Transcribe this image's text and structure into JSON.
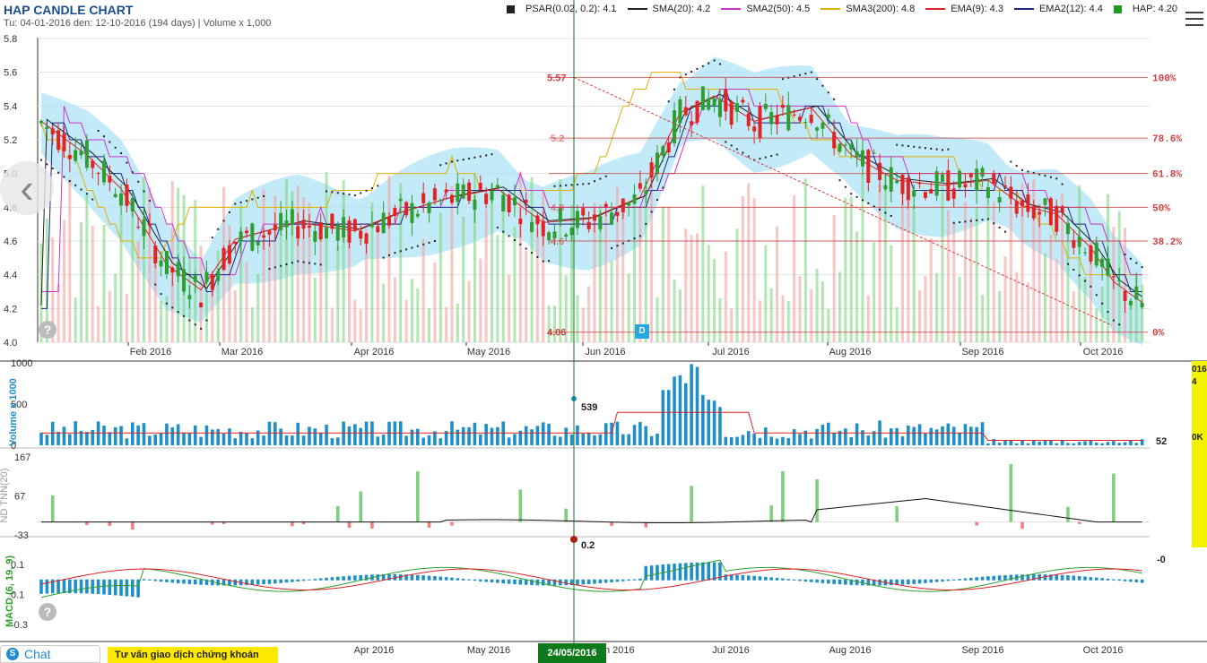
{
  "header": {
    "title": "HAP CANDLE CHART",
    "subtitle": "Tu: 04-01-2016 den: 12-10-2016 (194 days) | Volume x 1,000"
  },
  "legend": [
    {
      "label": "PSAR(0.02, 0.2): 4.1",
      "color": "#222222",
      "kind": "square"
    },
    {
      "label": "SMA(20): 4.2",
      "color": "#222222",
      "kind": "line"
    },
    {
      "label": "SMA2(50): 4.5",
      "color": "#cc33cc",
      "kind": "line"
    },
    {
      "label": "SMA3(200): 4.8",
      "color": "#e0b000",
      "kind": "line"
    },
    {
      "label": "EMA(9): 4.3",
      "color": "#dd2222",
      "kind": "line"
    },
    {
      "label": "EMA2(12): 4.4",
      "color": "#222288",
      "kind": "line"
    },
    {
      "label": "HAP: 4.20",
      "color": "#229922",
      "kind": "square"
    }
  ],
  "colors": {
    "up": "#2e9e2e",
    "down": "#e52222",
    "band": "#aee3f5",
    "volume": "#1f8fc8",
    "grid": "#999999",
    "cursor": "#0f7a1c"
  },
  "icons": {
    "menu": "hamburger-menu-icon",
    "nav": "chevron-left-icon",
    "help": "question-icon",
    "chat": "skype-icon"
  },
  "chat": {
    "label": "Chat"
  },
  "advice": {
    "label": "Tư vấn giao dịch chứng khoán"
  },
  "cursor": {
    "date_label": "24/05/2016",
    "volume_value": "539",
    "macd_value": "0.2"
  },
  "marker": {
    "label": "D"
  },
  "side_panel": {
    "lines": [
      "016",
      "4",
      "",
      "0K"
    ]
  },
  "chart_data": [
    {
      "type": "candlestick",
      "name": "price",
      "ylim": [
        4.0,
        5.8
      ],
      "yticks": [
        4.0,
        4.2,
        4.4,
        4.6,
        4.8,
        5.0,
        5.2,
        5.4,
        5.6,
        5.8
      ],
      "month_labels": [
        "Feb 2016",
        "Mar 2016",
        "Apr 2016",
        "May 2016",
        "Jun 2016",
        "Jul 2016",
        "Aug 2016",
        "Sep 2016",
        "Oct 2016"
      ],
      "fibonacci": {
        "high_label": "5.57",
        "low_label": "4.06",
        "levels": [
          {
            "value": 5.57,
            "label": "100%"
          },
          {
            "value": 5.21,
            "label": "78.6%"
          },
          {
            "value": 5.0,
            "label": "61.8%"
          },
          {
            "value": 4.8,
            "label": "50%"
          },
          {
            "value": 4.6,
            "label": "38.2%"
          },
          {
            "value": 4.06,
            "label": "0%"
          }
        ],
        "inner_labels": [
          "5.2",
          "4.8",
          "4.6"
        ]
      },
      "last_close": 4.2,
      "sma200_last": 4.8
    },
    {
      "type": "bar",
      "name": "volume",
      "ylabel": "Volume x 1000",
      "ylim": [
        0,
        1000
      ],
      "yticks": [
        0,
        500,
        1000
      ],
      "last_label": "52"
    },
    {
      "type": "bar",
      "name": "nd-tnn",
      "ylabel": "ND TNN(20)",
      "ylim": [
        -33,
        167
      ],
      "yticks": [
        -33,
        67,
        167
      ]
    },
    {
      "type": "line",
      "name": "macd",
      "ylabel": "MACD (6, 19, 9)",
      "ylim": [
        -0.3,
        0.1
      ],
      "yticks": [
        -0.3,
        -0.1,
        0.1
      ],
      "tick_labels": [
        "-0.3",
        "0.1",
        "0.1"
      ],
      "last_label": "-0"
    }
  ]
}
